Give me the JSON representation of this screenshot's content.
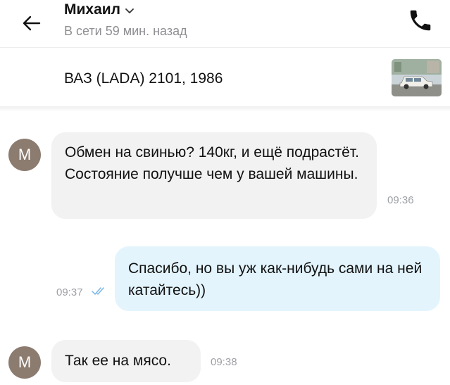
{
  "header": {
    "contact_name": "Михаил",
    "status": "В сети 59 мин. назад"
  },
  "listing": {
    "title": "ВАЗ (LADA) 2101, 1986"
  },
  "messages": [
    {
      "direction": "in",
      "avatar": "М",
      "text": "Обмен на свинью? 140кг, и ещё подрастёт. Состояние получше чем у вашей машины.",
      "time": "09:36"
    },
    {
      "direction": "out",
      "text": "Спасибо, но вы уж как-нибудь сами на ней катайтесь))",
      "time": "09:37",
      "read_icon": "double-check-icon"
    },
    {
      "direction": "in",
      "avatar": "М",
      "text": "Так ее на мясо.",
      "time": "09:38"
    }
  ],
  "colors": {
    "incoming_bubble": "#f2f2f3",
    "outgoing_bubble": "#e3f4fd",
    "avatar": "#8c7b6f",
    "read_check": "#7ab6e8"
  }
}
